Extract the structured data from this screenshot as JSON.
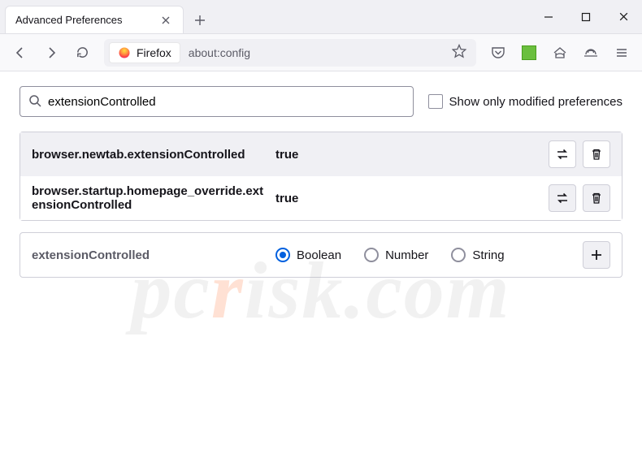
{
  "title_bar": {
    "tab_label": "Advanced Preferences"
  },
  "toolbar": {
    "identity_label": "Firefox",
    "url": "about:config"
  },
  "content": {
    "search_value": "extensionControlled",
    "modified_checkbox_label": "Show only modified preferences",
    "prefs": [
      {
        "name": "browser.newtab.extensionControlled",
        "value": "true"
      },
      {
        "name": "browser.startup.homepage_override.extensionControlled",
        "value": "true"
      }
    ],
    "new_pref": {
      "name": "extensionControlled",
      "types": [
        "Boolean",
        "Number",
        "String"
      ],
      "selected": "Boolean"
    }
  },
  "watermark": "pcrisk.com"
}
